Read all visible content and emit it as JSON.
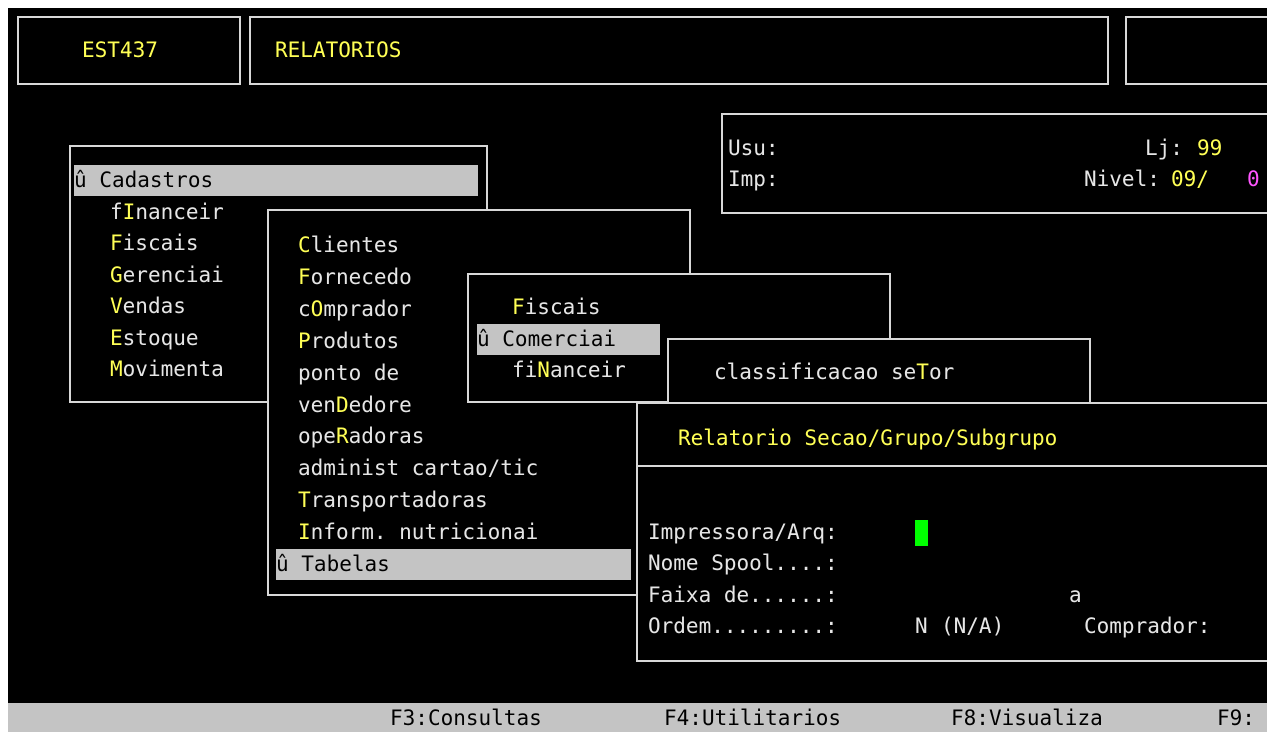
{
  "header": {
    "program_code": "EST437",
    "module_title": "RELATORIOS"
  },
  "info_panel": {
    "user_label": "Usu:",
    "user_value": "",
    "printer_label": "Imp:",
    "printer_value": "",
    "store_label": "Lj:",
    "store_value": "99",
    "level_label": "Nivel:",
    "level_value": "09/",
    "level_extra": "0"
  },
  "menu_main": {
    "marker": "û",
    "items": [
      {
        "hot": "",
        "rest": "Cadastros",
        "selected": true
      },
      {
        "pre": "f",
        "hot": "I",
        "rest": "nanceir"
      },
      {
        "hot": "F",
        "rest": "iscais"
      },
      {
        "hot": "G",
        "rest": "erenciai"
      },
      {
        "hot": "V",
        "rest": "endas"
      },
      {
        "hot": "E",
        "rest": "stoque"
      },
      {
        "hot": "M",
        "rest": "ovimenta"
      }
    ]
  },
  "menu_cadastros": {
    "items": [
      {
        "pre": "",
        "hot": "C",
        "rest": "lientes"
      },
      {
        "pre": "",
        "hot": "F",
        "rest": "ornecedo"
      },
      {
        "pre": "c",
        "hot": "O",
        "rest": "mprador"
      },
      {
        "pre": "",
        "hot": "P",
        "rest": "rodutos"
      },
      {
        "pre": "ponto de",
        "hot": "",
        "rest": ""
      },
      {
        "pre": "ven",
        "hot": "D",
        "rest": "edore"
      },
      {
        "pre": "ope",
        "hot": "R",
        "rest": "adoras"
      },
      {
        "pre": "administ cartao/tic",
        "hot": "",
        "rest": ""
      },
      {
        "pre": "",
        "hot": "T",
        "rest": "ransportadoras"
      },
      {
        "pre": "",
        "hot": "I",
        "rest": "nform. nutricionai"
      },
      {
        "pre": "û Tabelas",
        "hot": "",
        "rest": "",
        "selected": true
      }
    ]
  },
  "menu_produtos": {
    "items": [
      {
        "pre": "",
        "hot": "F",
        "rest": "iscais"
      },
      {
        "pre": "û Comerciai",
        "hot": "",
        "rest": "",
        "selected": true
      },
      {
        "pre": "fi",
        "hot": "N",
        "rest": "anceir"
      }
    ]
  },
  "menu_comercial": {
    "items": [
      {
        "pre": "classificacao se",
        "hot": "T",
        "rest": "or"
      }
    ]
  },
  "dialog": {
    "title": "Relatorio Secao/Grupo/Subgrupo",
    "printer_label": "Impressora/Arq:",
    "spool_label": "Nome Spool....:",
    "range_label": "Faixa de......:",
    "range_sep": "a",
    "order_label": "Ordem.........:",
    "order_value": "N",
    "order_hint": "(N/A)",
    "buyer_label": "Comprador:"
  },
  "function_keys": [
    {
      "key": "F3",
      "label": "Consultas"
    },
    {
      "key": "F4",
      "label": "Utilitarios"
    },
    {
      "key": "F8",
      "label": "Visualiza"
    },
    {
      "key": "F9",
      "label": ""
    }
  ],
  "colors": {
    "background": "#000000",
    "text": "#e6e6e6",
    "hotkey": "#ffff55",
    "highlight_bg": "#c4c4c4",
    "cursor": "#00ff00",
    "level_extra": "#ff55ff"
  }
}
